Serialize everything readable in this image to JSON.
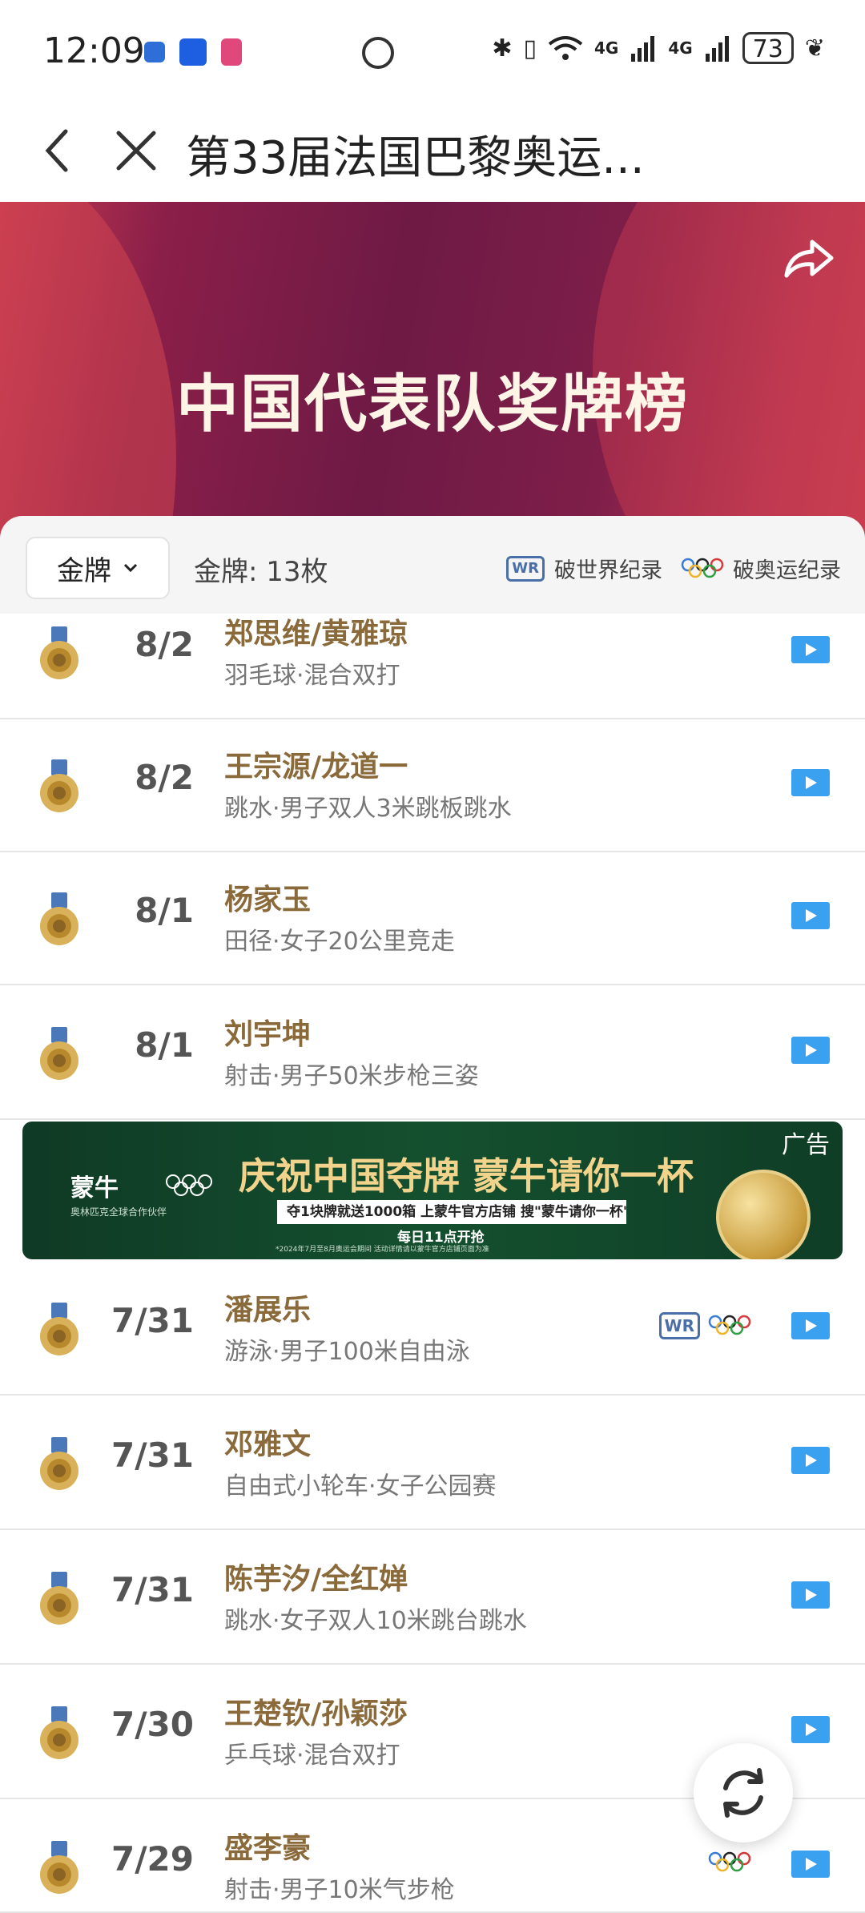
{
  "status_bar": {
    "time": "12:09",
    "network_1": "4G",
    "network_2": "4G",
    "battery": "73"
  },
  "nav": {
    "title": "第33届法国巴黎奥运..."
  },
  "banner": {
    "title": "中国代表队奖牌榜"
  },
  "filter": {
    "dropdown_label": "金牌",
    "count_text": "金牌: 13枚",
    "legend_wr_badge": "WR",
    "legend_wr": "破世界纪录",
    "legend_or": "破奥运纪录"
  },
  "colors": {
    "banner_main": "#6e1a45",
    "banner_accent": "#c63a52",
    "gold_text": "#8a6a3a",
    "play_blue": "#3aa0f0",
    "wr_blue": "#4a6fa8"
  },
  "medals": [
    {
      "date": "8/2",
      "name": "郑思维/黄雅琼",
      "event": "羽毛球·混合双打",
      "wr": false,
      "or": false
    },
    {
      "date": "8/2",
      "name": "王宗源/龙道一",
      "event": "跳水·男子双人3米跳板跳水",
      "wr": false,
      "or": false
    },
    {
      "date": "8/1",
      "name": "杨家玉",
      "event": "田径·女子20公里竞走",
      "wr": false,
      "or": false
    },
    {
      "date": "8/1",
      "name": "刘宇坤",
      "event": "射击·男子50米步枪三姿",
      "wr": false,
      "or": false
    },
    {
      "date": "7/31",
      "name": "潘展乐",
      "event": "游泳·男子100米自由泳",
      "wr": true,
      "or": true
    },
    {
      "date": "7/31",
      "name": "邓雅文",
      "event": "自由式小轮车·女子公园赛",
      "wr": false,
      "or": false
    },
    {
      "date": "7/31",
      "name": "陈芋汐/全红婵",
      "event": "跳水·女子双人10米跳台跳水",
      "wr": false,
      "or": false
    },
    {
      "date": "7/30",
      "name": "王楚钦/孙颖莎",
      "event": "乒乓球·混合双打",
      "wr": false,
      "or": false
    },
    {
      "date": "7/29",
      "name": "盛李豪",
      "event": "射击·男子10米气步枪",
      "wr": false,
      "or": true
    }
  ],
  "ad": {
    "tag": "广告",
    "brand": "蒙牛",
    "brand_sub": "奥林匹克全球合作伙伴",
    "headline": "庆祝中国夺牌 蒙牛请你一杯",
    "promo": "夺1块牌就送1000箱 上蒙牛官方店铺 搜\"蒙牛请你一杯\"",
    "time": "每日11点开抢",
    "fine_print": "*2024年7月至8月奥运会期间 活动详情请以蒙牛官方店铺页面为准"
  },
  "icons": {
    "back": "chevron-left-icon",
    "close": "close-icon",
    "share": "share-icon",
    "refresh": "refresh-icon",
    "play": "play-icon",
    "medal": "gold-medal-icon",
    "olympic": "olympic-rings-icon"
  }
}
